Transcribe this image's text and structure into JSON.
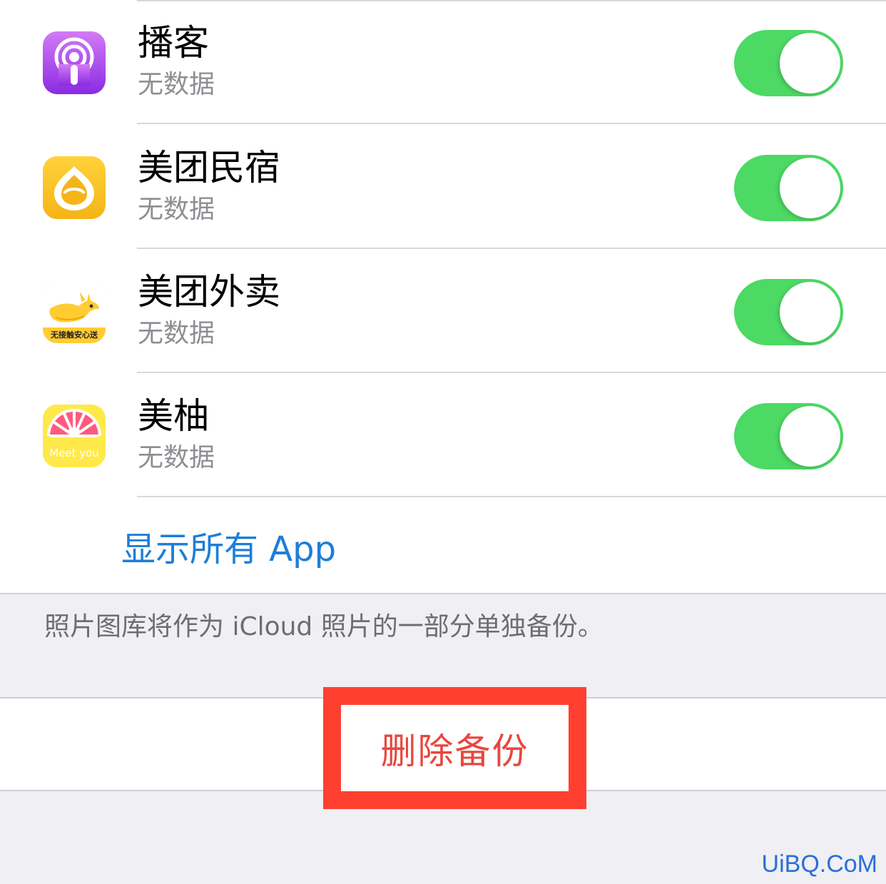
{
  "apps": [
    {
      "name": "播客",
      "status": "无数据",
      "icon": "podcasts-icon",
      "enabled": true
    },
    {
      "name": "美团民宿",
      "status": "无数据",
      "icon": "meituan-minsu-icon",
      "enabled": true
    },
    {
      "name": "美团外卖",
      "status": "无数据",
      "icon": "meituan-waimai-icon",
      "icon_text": "无接触安心送",
      "enabled": true
    },
    {
      "name": "美柚",
      "status": "无数据",
      "icon": "meiyou-icon",
      "icon_text": "Meet you",
      "enabled": true
    }
  ],
  "show_all_label": "显示所有 App",
  "footnote": "照片图库将作为 iCloud 照片的一部分单独备份。",
  "delete_backup_label": "删除备份",
  "watermark": "UiBQ.CoM",
  "colors": {
    "toggle_on": "#4cd964",
    "link_blue": "#1e7ed8",
    "destructive_red": "#e8473e",
    "highlight_red": "#ff4030",
    "group_background": "#efeff4"
  }
}
